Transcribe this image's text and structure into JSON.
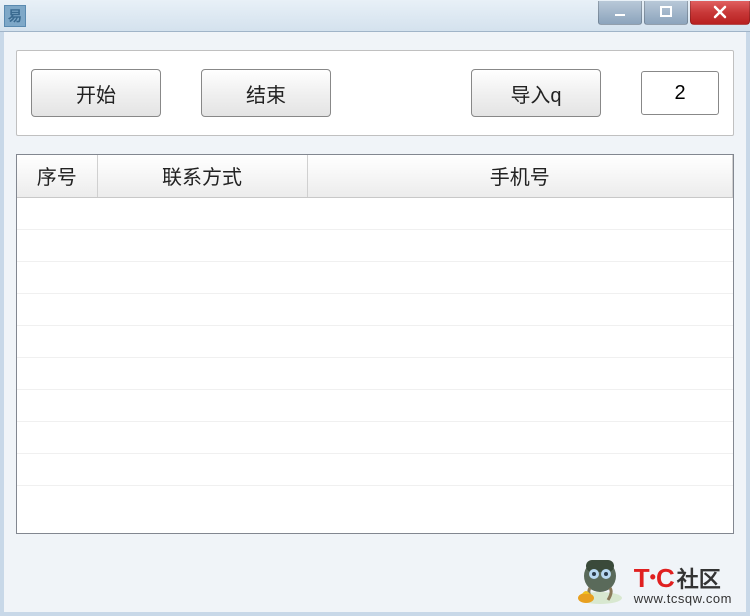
{
  "titlebar": {
    "app_icon_label": "易"
  },
  "toolbar": {
    "start_label": "开始",
    "end_label": "结束",
    "import_label": "导入q",
    "count_value": "2"
  },
  "listview": {
    "columns": {
      "seq": "序号",
      "contact": "联系方式",
      "phone": "手机号"
    },
    "rows": []
  },
  "watermark": {
    "brand_t": "T",
    "brand_c": "C",
    "brand_cn": "社区",
    "url": "www.tcsqw.com"
  }
}
